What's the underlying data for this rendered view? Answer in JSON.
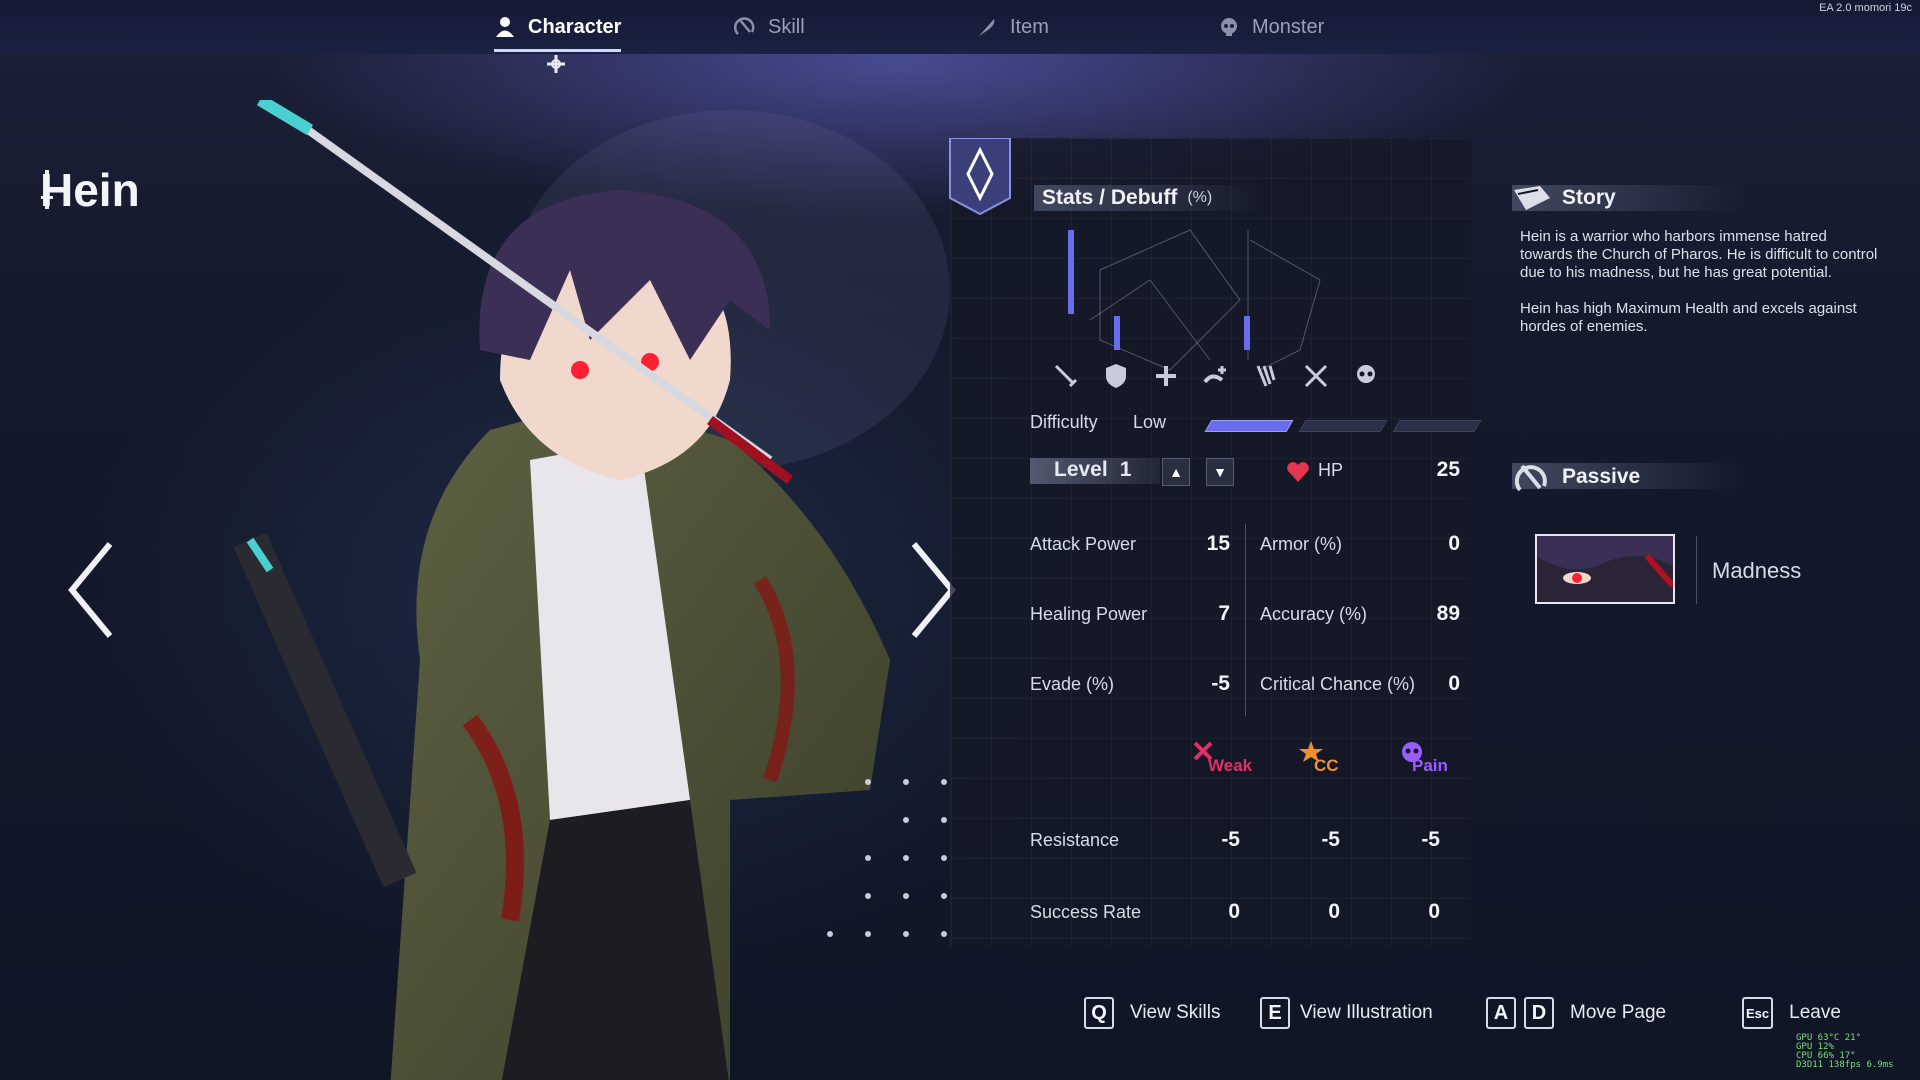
{
  "tabs": [
    {
      "label": "Character",
      "icon": "person-icon",
      "active": true
    },
    {
      "label": "Skill",
      "icon": "skill-swirl-icon",
      "active": false
    },
    {
      "label": "Item",
      "icon": "feather-icon",
      "active": false
    },
    {
      "label": "Monster",
      "icon": "skull-icon",
      "active": false
    }
  ],
  "build_label": "EA 2.0 momori 19c",
  "character": {
    "name": "Hein",
    "icon": "sword-icon"
  },
  "stats": {
    "header": "Stats / Debuff",
    "unit": "(%)",
    "chart_icons": [
      "sword-icon",
      "shield-icon",
      "plus-icon",
      "heal-icon",
      "claw-icon",
      "crossed-blades-icon",
      "skull-icon"
    ],
    "difficulty_label": "Difficulty",
    "difficulty_value": "Low",
    "difficulty_level": 1,
    "difficulty_max": 3,
    "level_label": "Level",
    "level_value": "1",
    "hp_label": "HP",
    "hp_value": "25",
    "rows": [
      {
        "left_label": "Attack Power",
        "left_value": "15",
        "right_label": "Armor (%)",
        "right_value": "0"
      },
      {
        "left_label": "Healing Power",
        "left_value": "7",
        "right_label": "Accuracy (%)",
        "right_value": "89"
      },
      {
        "left_label": "Evade (%)",
        "left_value": "-5",
        "right_label": "Critical Chance (%)",
        "right_value": "0"
      }
    ],
    "debuffs": [
      {
        "label": "Weak",
        "color": "#e0306a"
      },
      {
        "label": "CC",
        "color": "#f0902a"
      },
      {
        "label": "Pain",
        "color": "#9a5cff"
      }
    ],
    "resistance_label": "Resistance",
    "resistance_values": [
      "-5",
      "-5",
      "-5"
    ],
    "success_label": "Success Rate",
    "success_values": [
      "0",
      "0",
      "0"
    ]
  },
  "story": {
    "header": "Story",
    "paragraphs": [
      "Hein is a warrior who harbors immense hatred towards the Church of Pharos. He is difficult to control due to his madness, but he has great potential.",
      "Hein has high Maximum Health and excels against hordes of enemies."
    ]
  },
  "passive": {
    "header": "Passive",
    "name": "Madness"
  },
  "footer": [
    {
      "keys": [
        "Q"
      ],
      "label": "View Skills"
    },
    {
      "keys": [
        "E"
      ],
      "label": "View Illustration"
    },
    {
      "keys": [
        "A",
        "D"
      ],
      "label": "Move Page"
    },
    {
      "keys": [
        "Esc"
      ],
      "label": "Leave"
    }
  ],
  "osd": {
    "lines": [
      "GPU  63°C  21°",
      "GPU  12%",
      "CPU  66%  17°",
      "D3D11 138fps 6.9ms"
    ]
  },
  "colors": {
    "accent": "#6a6cf0",
    "hp": "#e23650",
    "panel": "#141826"
  }
}
